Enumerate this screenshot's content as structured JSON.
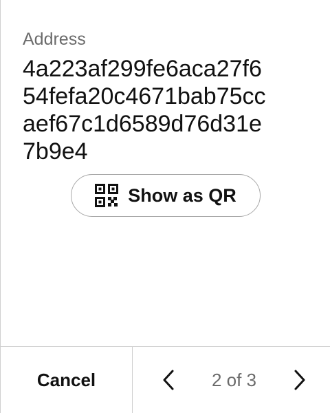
{
  "address": {
    "label": "Address",
    "lines": [
      "4a223af299fe6aca27f6",
      "54fefa20c4671bab75cc",
      "aef67c1d6589d76d31e",
      "7b9e4"
    ]
  },
  "qr_button": {
    "icon": "qr-code-icon",
    "label": "Show as QR"
  },
  "footer": {
    "cancel_label": "Cancel",
    "pager": {
      "prev_icon": "chevron-left-icon",
      "text": "2 of 3",
      "next_icon": "chevron-right-icon"
    }
  }
}
